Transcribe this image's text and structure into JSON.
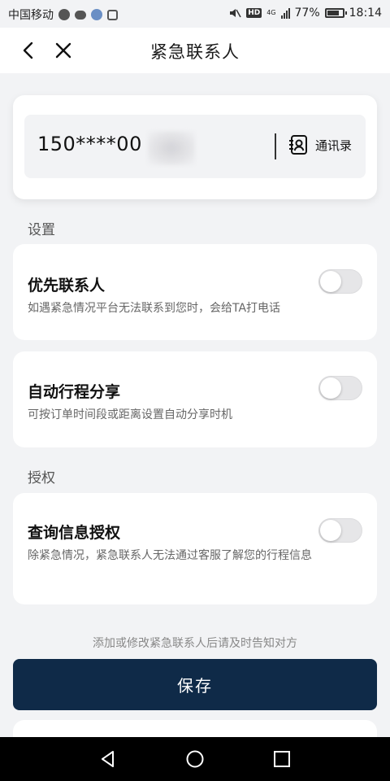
{
  "status_bar": {
    "carrier": "中国移动",
    "network": "4G",
    "battery_percent": "77%",
    "battery_level": 0.77,
    "time": "18:14",
    "icons": [
      "wechat-icon",
      "message-bubble-icon",
      "weather-icon",
      "app-icon",
      "mute-icon",
      "hd-icon",
      "signal-icon",
      "battery-icon"
    ]
  },
  "header": {
    "title": "紧急联系人",
    "back_icon": "back-arrow-icon",
    "close_icon": "close-icon"
  },
  "phone": {
    "value": "150****00",
    "contacts_label": "通讯录",
    "contacts_icon": "contacts-book-icon"
  },
  "sections": {
    "settings_label": "设置",
    "auth_label": "授权"
  },
  "settings": [
    {
      "title": "优先联系人",
      "description": "如遇紧急情况平台无法联系到您时，会给TA打电话",
      "enabled": false
    },
    {
      "title": "自动行程分享",
      "description": "可按订单时间段或距离设置自动分享时机",
      "enabled": false
    },
    {
      "title": "查询信息授权",
      "description": "除紧急情况，紧急联系人无法通过客服了解您的行程信息",
      "enabled": false
    }
  ],
  "notice": "添加或修改紧急联系人后请及时告知对方",
  "save_label": "保存",
  "nav": {
    "back": "nav-back-icon",
    "home": "nav-home-icon",
    "recent": "nav-recent-icon"
  },
  "colors": {
    "primary_button": "#0f2a48",
    "background": "#f2f3f5",
    "toggle_off": "#e6e6e8"
  }
}
